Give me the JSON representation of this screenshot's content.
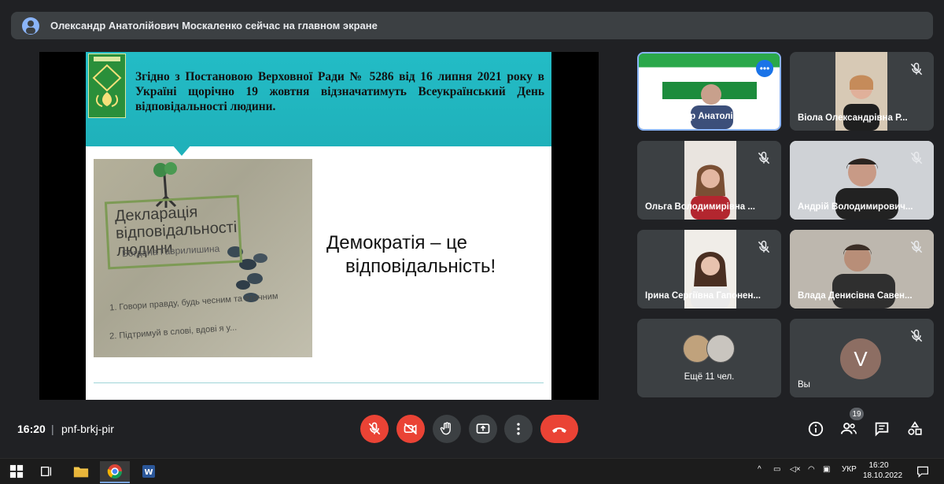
{
  "banner": {
    "text": "Олександр Анатолійович Москаленко сейчас на главном экране"
  },
  "slide": {
    "title": "Згідно з Постановою Верховної Ради № 5286 від 16 липня 2021 року в Україні щорічно 19 жовтня відзначатимуть Всеукраїнський День відповідальності людини.",
    "photo_heading": "Декларація відповідальності людини",
    "photo_author": "Богдана Гаврилишина",
    "photo_item1": "1. Говори правду, будь чесним та етичним",
    "photo_item2": "2. Підтримуй в слові, вдові я у...",
    "quote_line1": "Демократія – це",
    "quote_line2": "відповідальність!"
  },
  "participants": [
    {
      "name": "Олександр Анатолійов...",
      "muted": false,
      "banner_text": "КИЇВСЬКИЙ УНІВЕРСИТЕТ ІМЕНІ БОРИСА ГРІНЧЕНКА"
    },
    {
      "name": "Віола Олександрівна Р...",
      "muted": true
    },
    {
      "name": "Ольга Володимирівна ...",
      "muted": true
    },
    {
      "name": "Андрій Володимирович...",
      "muted": true
    },
    {
      "name": "Ірина Сергіївна Гапонен...",
      "muted": true
    },
    {
      "name": "Влада Денисівна Савен...",
      "muted": true
    }
  ],
  "more": {
    "label": "Ещё 11 чел."
  },
  "you": {
    "initial": "V",
    "label": "Вы"
  },
  "controls": {
    "time": "16:20",
    "meeting_code": "pnf-brkj-pir",
    "participants_count": "19"
  },
  "taskbar": {
    "lang": "УКР",
    "time": "16:20",
    "date": "18.10.2022"
  },
  "colors": {
    "bg": "#202124",
    "tile": "#3c4043",
    "red": "#ea4335",
    "accent": "#8ab4f8",
    "slide_header": "#23bcc6"
  }
}
